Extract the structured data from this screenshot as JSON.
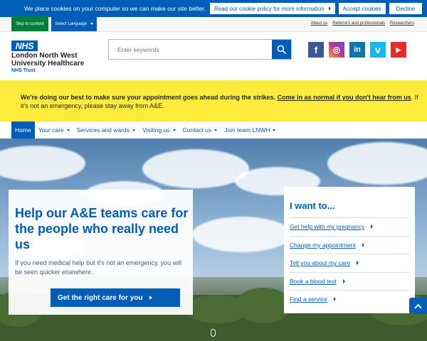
{
  "cookie_banner": {
    "message": "We place cookies on your computer so we can make our site better.",
    "policy_label": "Read our cookie policy for more information",
    "accept_label": "Accept cookies",
    "decline_label": "Decline"
  },
  "utility_bar": {
    "skip_label": "Skip to content",
    "language_label": "Select Language",
    "links": [
      "About us",
      "Referrers and professionals",
      "Researchers"
    ]
  },
  "logo": {
    "badge": "NHS",
    "name_lines": [
      "London North West",
      "University Healthcare"
    ],
    "trust": "NHS Trust"
  },
  "search": {
    "placeholder": "Enter keywords",
    "icon": "search-icon"
  },
  "social": [
    {
      "name": "facebook-icon",
      "glyph": "f",
      "color": "#3b5998"
    },
    {
      "name": "instagram-icon",
      "glyph": "◎",
      "color": "#c13584"
    },
    {
      "name": "linkedin-icon",
      "glyph": "in",
      "color": "#0e76a8"
    },
    {
      "name": "vimeo-icon",
      "glyph": "v",
      "color": "#1ab7ea"
    },
    {
      "name": "youtube-icon",
      "glyph": "▶",
      "color": "#e52d27"
    }
  ],
  "strike_banner": {
    "bold_text": "We're doing our best to make sure your appointment goes ahead during the strikes.",
    "link_text": "Come in as normal if you don't hear from us",
    "rest_text": ". If it's not an emergency, please stay away from A&E."
  },
  "nav": {
    "items": [
      {
        "label": "Home",
        "active": true,
        "dropdown": false
      },
      {
        "label": "Your care",
        "dropdown": true
      },
      {
        "label": "Services and wards",
        "dropdown": true
      },
      {
        "label": "Visiting us",
        "dropdown": true
      },
      {
        "label": "Contact us",
        "dropdown": true
      },
      {
        "label": "Join team LNWH",
        "dropdown": true
      }
    ]
  },
  "hero": {
    "heading": "Help our A&E teams care for the people who really need us",
    "body": "If you need medical help but it's not an emergency, you will be seen quicker elsewhere.",
    "button_label": "Get the right care for you"
  },
  "want_to": {
    "title": "I want to...",
    "items": [
      "Get help with my pregnancy",
      "Change my appointment",
      "Tell you about my care",
      "Book a blood test",
      "Find a service"
    ]
  },
  "colors": {
    "nhs_blue": "#005eb8",
    "nhs_green": "#007f3b",
    "banner_yellow": "#ffeb3b"
  }
}
